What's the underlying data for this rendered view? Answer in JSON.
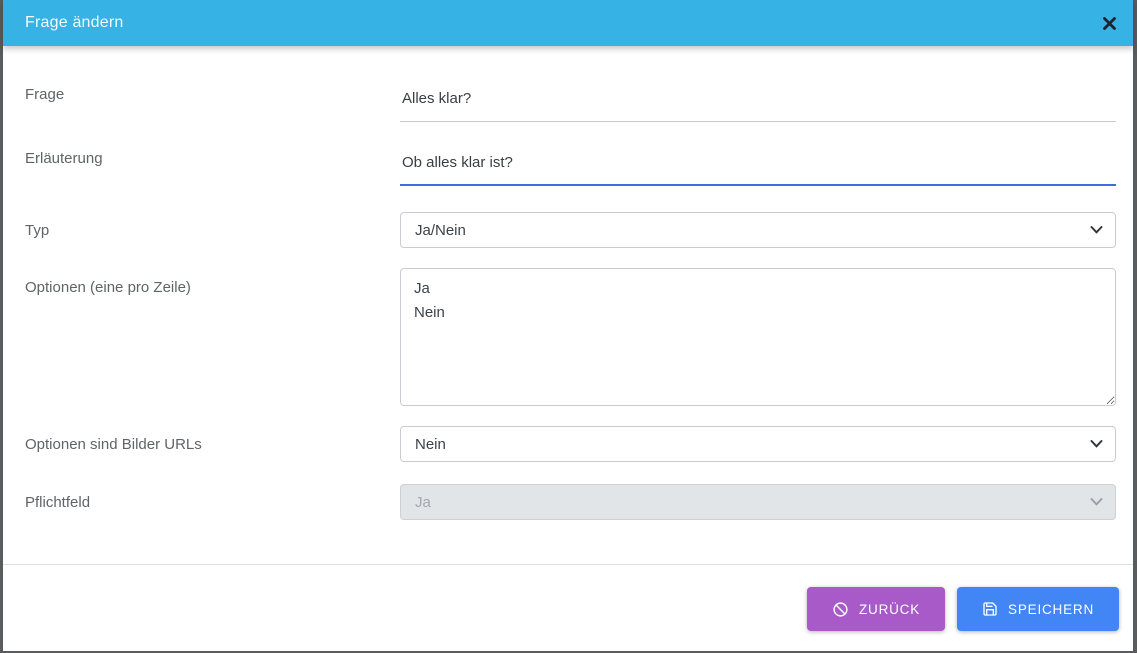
{
  "dialog": {
    "title": "Frage ändern"
  },
  "form": {
    "fields": [
      {
        "label": "Frage",
        "type": "text",
        "value": "Alles klar?"
      },
      {
        "label": "Erläuterung",
        "type": "text",
        "value": "Ob alles klar ist?",
        "focused": true
      },
      {
        "label": "Typ",
        "type": "select",
        "value": "Ja/Nein"
      },
      {
        "label": "Optionen (eine pro Zeile)",
        "type": "textarea",
        "value": "Ja\nNein"
      },
      {
        "label": "Optionen sind Bilder URLs",
        "type": "select",
        "value": "Nein"
      },
      {
        "label": "Pflichtfeld",
        "type": "select",
        "value": "Ja",
        "disabled": true
      }
    ]
  },
  "footer": {
    "back_label": "ZURÜCK",
    "save_label": "SPEICHERN"
  },
  "colors": {
    "header_bg": "#36b2e4",
    "focus_underline": "#3b70d9",
    "back_button_bg": "#a75ac8",
    "save_button_bg": "#4285f4",
    "overlay_bg": "#5a5b5d"
  },
  "icons": {
    "close": "close-icon",
    "back": "ban-icon",
    "save": "save-icon",
    "select": "chevron-down-icon"
  }
}
